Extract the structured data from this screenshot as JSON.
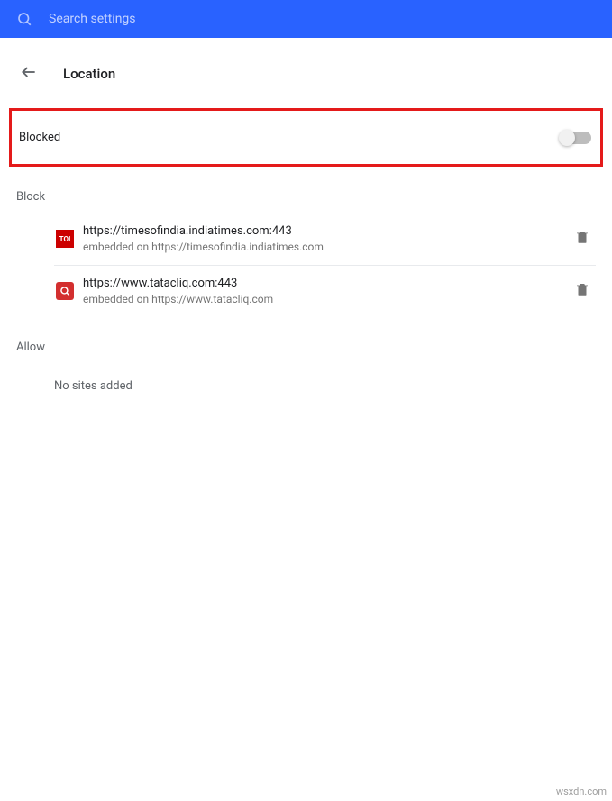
{
  "header": {
    "search_placeholder": "Search settings"
  },
  "page": {
    "title": "Location"
  },
  "blocked_toggle": {
    "label": "Blocked",
    "enabled": false
  },
  "sections": {
    "block": {
      "heading": "Block",
      "items": [
        {
          "favicon_label": "TOI",
          "url": "https://timesofindia.indiatimes.com:443",
          "embedded": "embedded on https://timesofindia.indiatimes.com"
        },
        {
          "favicon_label": "Q",
          "url": "https://www.tatacliq.com:443",
          "embedded": "embedded on https://www.tatacliq.com"
        }
      ]
    },
    "allow": {
      "heading": "Allow",
      "empty_text": "No sites added"
    }
  },
  "watermark": "wsxdn.com"
}
